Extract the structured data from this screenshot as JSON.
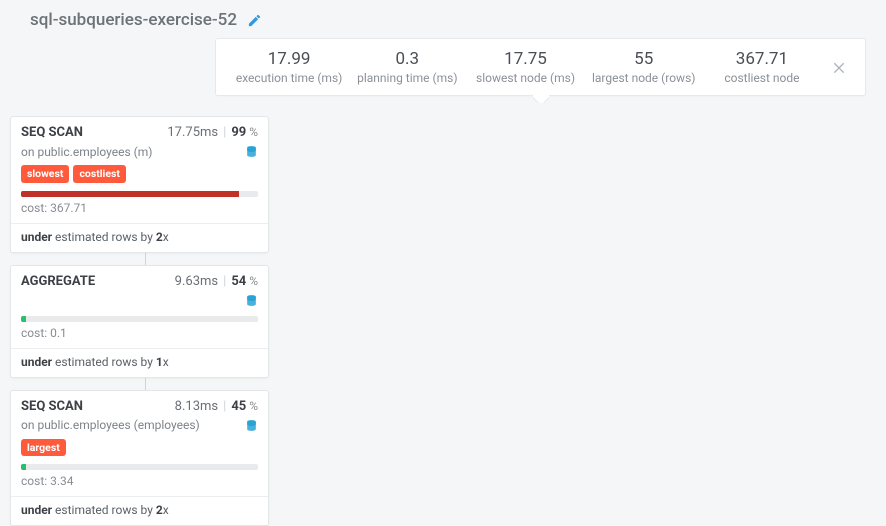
{
  "title": "sql-subqueries-exercise-52",
  "stats": [
    {
      "value": "17.99",
      "label": "execution time (ms)"
    },
    {
      "value": "0.3",
      "label": "planning time (ms)"
    },
    {
      "value": "17.75",
      "label": "slowest node (ms)"
    },
    {
      "value": "55",
      "label": "largest node (rows)"
    },
    {
      "value": "367.71",
      "label": "costliest node"
    }
  ],
  "nodes": [
    {
      "name": "SEQ SCAN",
      "time": "17.75ms",
      "pct": "99",
      "relation_prefix": "on ",
      "relation": "public.employees (m)",
      "tags": [
        "slowest",
        "costliest"
      ],
      "bar_color": "bar-red",
      "bar_width": "92%",
      "cost_label": "cost: ",
      "cost": "367.71",
      "est_prefix": "under",
      "est_mid": " estimated rows by ",
      "est_factor": "2",
      "est_suffix": "x"
    },
    {
      "name": "AGGREGATE",
      "time": "9.63ms",
      "pct": "54",
      "relation_prefix": "",
      "relation": "",
      "tags": [],
      "bar_color": "bar-green",
      "bar_width": "2%",
      "cost_label": "cost: ",
      "cost": "0.1",
      "est_prefix": "under",
      "est_mid": " estimated rows by ",
      "est_factor": "1",
      "est_suffix": "x"
    },
    {
      "name": "SEQ SCAN",
      "time": "8.13ms",
      "pct": "45",
      "relation_prefix": "on ",
      "relation": "public.employees (employees)",
      "tags": [
        "largest"
      ],
      "bar_color": "bar-green",
      "bar_width": "2%",
      "cost_label": "cost: ",
      "cost": "3.34",
      "est_prefix": "under",
      "est_mid": " estimated rows by ",
      "est_factor": "2",
      "est_suffix": "x"
    }
  ],
  "pct_unit": " %"
}
